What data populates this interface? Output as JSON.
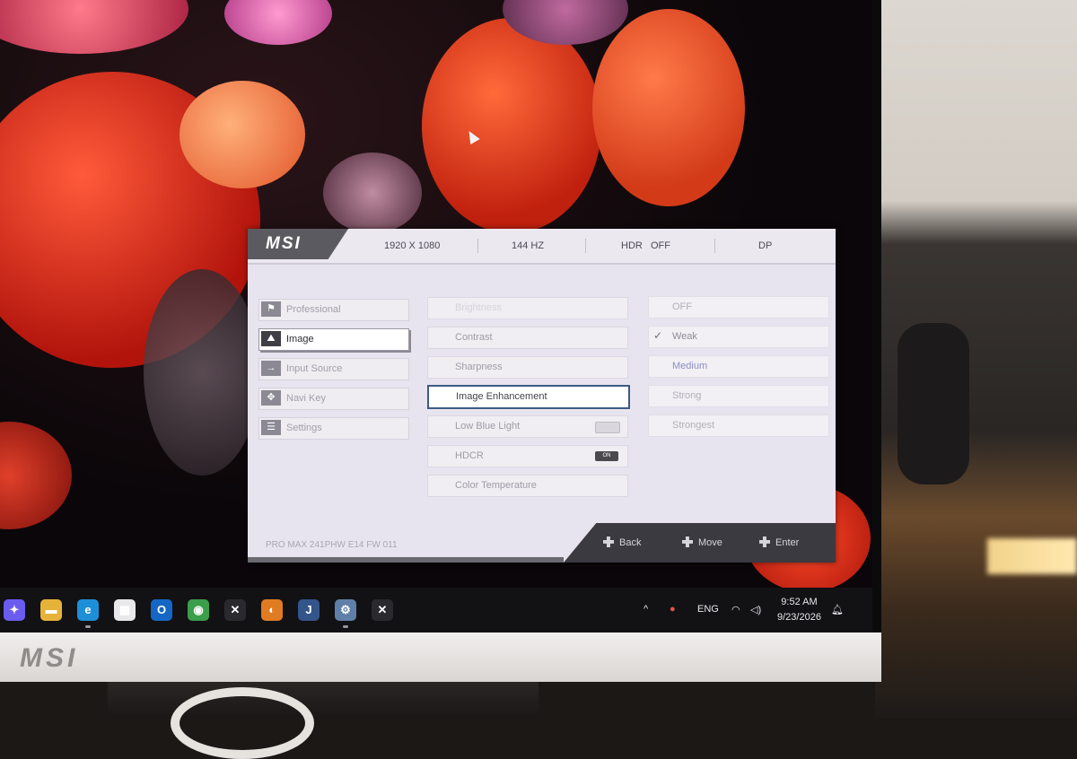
{
  "osd": {
    "brand": "MSI",
    "status": {
      "resolution": "1920 X 1080",
      "refresh": "144 HZ",
      "hdr_label": "HDR",
      "hdr_value": "OFF",
      "input": "DP"
    },
    "menu": [
      {
        "label": "Professional",
        "icon": "flag-icon",
        "active": false
      },
      {
        "label": "Image",
        "icon": "image-icon",
        "active": true
      },
      {
        "label": "Input Source",
        "icon": "arrow-right-icon",
        "active": false
      },
      {
        "label": "Navi Key",
        "icon": "joystick-icon",
        "active": false
      },
      {
        "label": "Settings",
        "icon": "sliders-icon",
        "active": false
      }
    ],
    "submenu": [
      {
        "label": "Brightness"
      },
      {
        "label": "Contrast"
      },
      {
        "label": "Sharpness"
      },
      {
        "label": "Image Enhancement",
        "active": true
      },
      {
        "label": "Low Blue Light",
        "toggle": "off"
      },
      {
        "label": "HDCR",
        "toggle": "on",
        "toggle_text": "ON"
      },
      {
        "label": "Color Temperature"
      }
    ],
    "options": [
      {
        "label": "OFF"
      },
      {
        "label": "Weak",
        "selected": true
      },
      {
        "label": "Medium"
      },
      {
        "label": "Strong"
      },
      {
        "label": "Strongest"
      }
    ],
    "model_info": "PRO MAX 241PHW E14  FW 011",
    "nav": {
      "back": "Back",
      "move": "Move",
      "enter": "Enter"
    }
  },
  "taskbar": {
    "apps": [
      {
        "name": "copilot-icon",
        "color": "#6b5cf0",
        "glyph": "✦"
      },
      {
        "name": "file-explorer-icon",
        "color": "#e6b33a",
        "glyph": "▬"
      },
      {
        "name": "edge-icon",
        "color": "#1d8fd8",
        "glyph": "e"
      },
      {
        "name": "microsoft-store-icon",
        "color": "#e8e8ea",
        "glyph": "▦"
      },
      {
        "name": "outlook-icon",
        "color": "#1467c4",
        "glyph": "O"
      },
      {
        "name": "chrome-icon",
        "color": "#3a9e4a",
        "glyph": "◉"
      },
      {
        "name": "capcut-icon",
        "color": "#2a2a2e",
        "glyph": "✕"
      },
      {
        "name": "blender-icon",
        "color": "#e07b22",
        "glyph": "◐"
      },
      {
        "name": "jpeg-viewer-icon",
        "color": "#33558a",
        "glyph": "J"
      },
      {
        "name": "settings-gear-icon",
        "color": "#5f7fa8",
        "glyph": "⚙"
      },
      {
        "name": "capcut-icon-2",
        "color": "#2a2a2e",
        "glyph": "✕"
      }
    ],
    "tray": {
      "language": "ENG",
      "time": "9:52 AM",
      "date": "9/23/2026"
    }
  },
  "bezel": {
    "logo": "MSI"
  }
}
